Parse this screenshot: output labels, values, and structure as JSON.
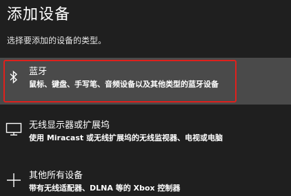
{
  "page": {
    "title": "添加设备",
    "subtitle": "选择要添加的设备的类型。"
  },
  "options": [
    {
      "icon": "bluetooth-icon",
      "title": "蓝牙",
      "description": "鼠标、键盘、手写笔、音频设备以及其他类型的蓝牙设备",
      "highlighted": true
    },
    {
      "icon": "monitor-icon",
      "title": "无线显示器或扩展坞",
      "description": "使用 Miracast 或无线扩展坞的无线监视器、电视或电脑",
      "highlighted": false
    },
    {
      "icon": "plus-icon",
      "title": "其他所有设备",
      "description": "带有无线适配器、DLNA 等的 Xbox 控制器",
      "highlighted": false
    }
  ],
  "colors": {
    "background": "#1f1f1f",
    "highlight": "#4a4a4a",
    "focus_outline": "#e0201c",
    "text": "#ffffff"
  }
}
